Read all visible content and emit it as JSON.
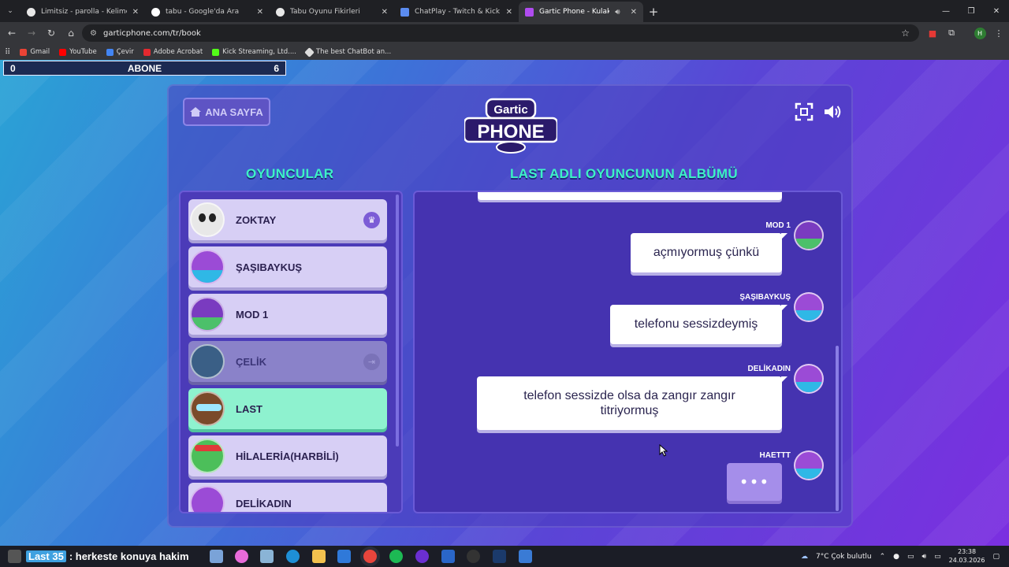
{
  "browser": {
    "tabs": [
      {
        "title": "Limitsiz - parolla - Kelime oyunu",
        "favicon": "parolla",
        "active": false
      },
      {
        "title": "tabu - Google'da Ara",
        "favicon": "google",
        "active": false
      },
      {
        "title": "Tabu Oyunu Fikirleri",
        "favicon": "chatgpt",
        "active": false
      },
      {
        "title": "ChatPlay - Twitch & Kick İzleyici",
        "favicon": "chatplay",
        "active": false
      },
      {
        "title": "Gartic Phone - Kulaktan Kulağa",
        "favicon": "gartic",
        "active": true
      }
    ],
    "url": "garticphone.com/tr/book",
    "bookmarks": [
      {
        "label": "Gmail",
        "color": "#ea4335"
      },
      {
        "label": "YouTube",
        "color": "#ff0000"
      },
      {
        "label": "Çevir",
        "color": "#4285f4"
      },
      {
        "label": "Adobe Acrobat",
        "color": "#e4292f"
      },
      {
        "label": "Kick Streaming, Ltd....",
        "color": "#53fc18"
      },
      {
        "label": "The best ChatBot an...",
        "color": "#dddddd"
      }
    ],
    "profile_initial": "H"
  },
  "scoreboard": {
    "left": "0",
    "label": "ABONE",
    "right": "6"
  },
  "game": {
    "home_label": "ANA SAYFA",
    "logo_top": "Gartic",
    "logo_bottom": "PHONE",
    "players_heading": "OYUNCULAR",
    "album_heading": "LAST ADLI OYUNCUNUN ALBÜMÜ",
    "players": [
      {
        "name": "ZOKTAY",
        "state": "host",
        "badge": "♛"
      },
      {
        "name": "ŞAŞIBAYKUŞ",
        "state": "normal"
      },
      {
        "name": "MOD 1",
        "state": "normal"
      },
      {
        "name": "ÇELİK",
        "state": "left",
        "badge": "⇥"
      },
      {
        "name": "LAST",
        "state": "current"
      },
      {
        "name": "HİLALERİA(HARBİLİ)",
        "state": "normal"
      },
      {
        "name": "DELİKADIN",
        "state": "normal"
      }
    ],
    "album": [
      {
        "author": "MOD 1",
        "text": "açmıyormuş çünkü"
      },
      {
        "author": "ŞAŞIBAYKUŞ",
        "text": "telefonu sessizdeymiş"
      },
      {
        "author": "DELİKADIN",
        "text": "telefon sessizde olsa da zangır zangır titriyormuş"
      },
      {
        "author": "HAETTT",
        "text": "•••"
      }
    ]
  },
  "taskbar": {
    "ticker_user": "Last 35",
    "ticker_text": ": herkeste konuya hakim",
    "weather": "7°C  Çok bulutlu",
    "time": "23:38",
    "date": "24.03.2026"
  },
  "colors": {
    "accent_heading": "#3df2c6",
    "panel": "#4533b0",
    "current_player": "#8ef2cf"
  }
}
